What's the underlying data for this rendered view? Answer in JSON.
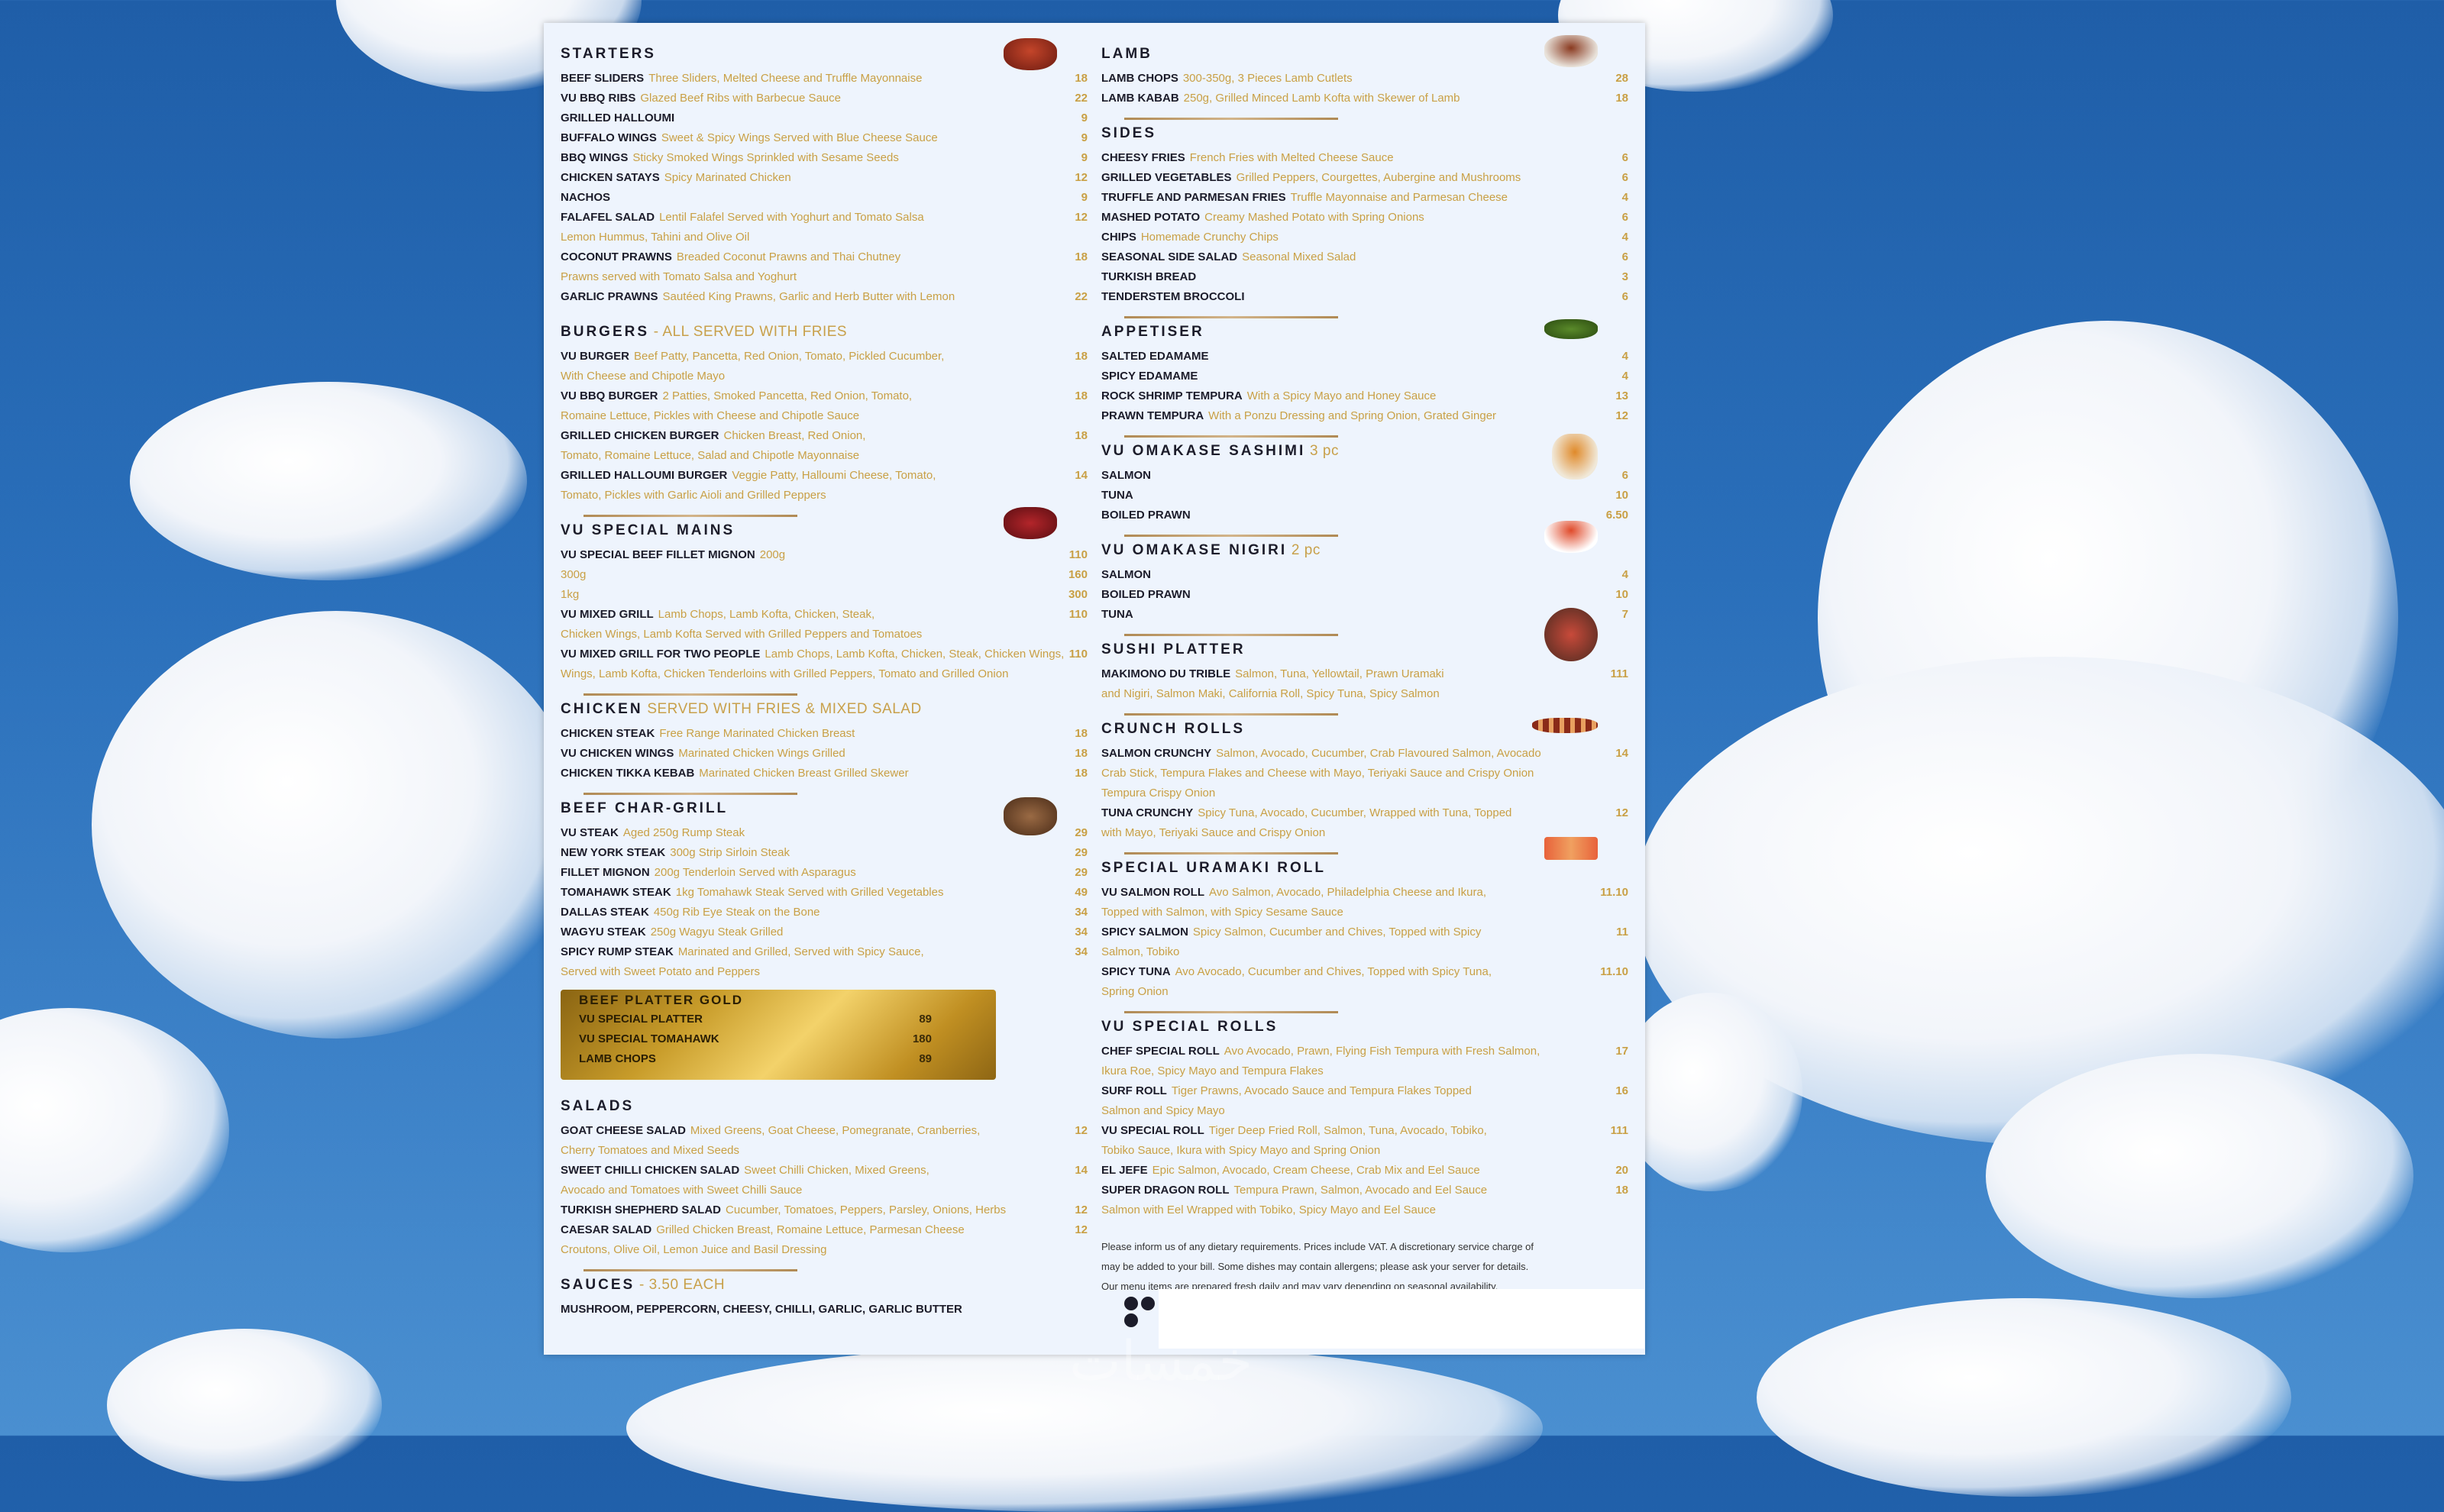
{
  "colors": {
    "sky": "#2a6fba",
    "paper": "#eef4fd",
    "gold": "#c9a045",
    "ink": "#1c1c2a"
  },
  "left": {
    "starters": {
      "title": "STARTERS",
      "items": [
        {
          "name": "BEEF SLIDERS",
          "desc": "Three Sliders, Melted Cheese and Truffle Mayonnaise",
          "price": "18"
        },
        {
          "name": "VU BBQ RIBS",
          "desc": "Glazed Beef Ribs with Barbecue Sauce",
          "price": "22"
        },
        {
          "name": "GRILLED HALLOUMI",
          "desc": "",
          "price": "9"
        },
        {
          "name": "BUFFALO WINGS",
          "desc": "Sweet & Spicy Wings Served with Blue Cheese Sauce",
          "price": "9"
        },
        {
          "name": "BBQ WINGS",
          "desc": "Sticky Smoked Wings Sprinkled with Sesame Seeds",
          "price": "9"
        },
        {
          "name": "CHICKEN SATAYS",
          "desc": "Spicy Marinated Chicken",
          "price": "12"
        },
        {
          "name": "NACHOS",
          "desc": "",
          "price": "9"
        },
        {
          "name": "FALAFEL SALAD",
          "desc": "Lentil Falafel Served with Yoghurt and Tomato Salsa",
          "price": "12"
        },
        {
          "name": "",
          "desc": "Lemon Hummus, Tahini and Olive Oil",
          "price": ""
        },
        {
          "name": "COCONUT PRAWNS",
          "desc": "Breaded Coconut Prawns and Thai Chutney",
          "price": "18"
        },
        {
          "name": "",
          "desc": "Prawns served with Tomato Salsa and Yoghurt",
          "price": ""
        },
        {
          "name": "GARLIC PRAWNS",
          "desc": "Sautéed King Prawns, Garlic and Herb Butter with Lemon",
          "price": "22"
        }
      ]
    },
    "burgers": {
      "title": "BURGERS",
      "subtitle": " - ALL SERVED WITH FRIES",
      "items": [
        {
          "name": "VU BURGER",
          "desc": "Beef Patty, Pancetta, Red Onion, Tomato, Pickled Cucumber,",
          "price": "18"
        },
        {
          "name": "",
          "desc": "With Cheese and Chipotle Mayo",
          "price": ""
        },
        {
          "name": "VU BBQ BURGER",
          "desc": "2 Patties, Smoked Pancetta, Red Onion, Tomato,",
          "price": "18"
        },
        {
          "name": "",
          "desc": "Romaine Lettuce, Pickles with Cheese and Chipotle Sauce",
          "price": ""
        },
        {
          "name": "GRILLED CHICKEN BURGER",
          "desc": "Chicken Breast, Red Onion,",
          "price": "18"
        },
        {
          "name": "",
          "desc": "Tomato, Romaine Lettuce, Salad and Chipotle Mayonnaise",
          "price": ""
        },
        {
          "name": "GRILLED HALLOUMI BURGER",
          "desc": "Veggie Patty, Halloumi Cheese, Tomato,",
          "price": "14"
        },
        {
          "name": "",
          "desc": "Tomato, Pickles with Garlic Aioli and Grilled Peppers",
          "price": ""
        }
      ]
    },
    "vu_mains": {
      "title": "VU SPECIAL MAINS",
      "items": [
        {
          "name": "VU SPECIAL BEEF FILLET MIGNON",
          "desc": "200g",
          "price": "110"
        },
        {
          "name": "",
          "desc": "300g",
          "price": "160"
        },
        {
          "name": "",
          "desc": "1kg",
          "price": "300"
        },
        {
          "name": "VU MIXED GRILL",
          "desc": "Lamb Chops, Lamb Kofta, Chicken, Steak,",
          "price": "110"
        },
        {
          "name": "",
          "desc": "Chicken Wings, Lamb Kofta Served with Grilled Peppers and Tomatoes",
          "price": ""
        },
        {
          "name": "VU MIXED GRILL FOR TWO PEOPLE",
          "desc": "Lamb Chops, Lamb Kofta, Chicken, Steak, Chicken Wings,",
          "price": "110"
        },
        {
          "name": "",
          "desc": "Wings, Lamb Kofta, Chicken Tenderloins with Grilled Peppers, Tomato and Grilled Onion",
          "price": ""
        }
      ]
    },
    "chicken": {
      "title": "CHICKEN",
      "subtitle": " SERVED WITH FRIES & MIXED SALAD",
      "items": [
        {
          "name": "CHICKEN STEAK",
          "desc": "Free Range Marinated Chicken Breast",
          "price": "18"
        },
        {
          "name": "VU CHICKEN WINGS",
          "desc": "Marinated Chicken Wings Grilled",
          "price": "18"
        },
        {
          "name": "CHICKEN TIKKA KEBAB",
          "desc": "Marinated Chicken Breast Grilled Skewer",
          "price": "18"
        }
      ]
    },
    "beef": {
      "title": "BEEF CHAR-GRILL",
      "items": [
        {
          "name": "VU STEAK",
          "desc": "Aged 250g Rump Steak",
          "price": "29"
        },
        {
          "name": "NEW YORK STEAK",
          "desc": "300g Strip Sirloin Steak",
          "price": "29"
        },
        {
          "name": "FILLET MIGNON",
          "desc": "200g Tenderloin Served with Asparagus",
          "price": "29"
        },
        {
          "name": "TOMAHAWK STEAK",
          "desc": "1kg Tomahawk Steak Served with Grilled Vegetables",
          "price": "49"
        },
        {
          "name": "DALLAS STEAK",
          "desc": "450g Rib Eye Steak on the Bone",
          "price": "34"
        },
        {
          "name": "WAGYU STEAK",
          "desc": "250g Wagyu Steak Grilled",
          "price": "34"
        },
        {
          "name": "SPICY RUMP STEAK",
          "desc": "Marinated and Grilled, Served with Spicy Sauce,",
          "price": "34"
        },
        {
          "name": "",
          "desc": "Served with Sweet Potato and Peppers",
          "price": ""
        }
      ]
    },
    "gold": {
      "title": "BEEF PLATTER GOLD",
      "items": [
        {
          "name": "VU SPECIAL PLATTER",
          "price": "89"
        },
        {
          "name": "VU SPECIAL TOMAHAWK",
          "price": "180"
        },
        {
          "name": "LAMB CHOPS",
          "price": "89"
        }
      ]
    },
    "salads": {
      "title": "SALADS",
      "items": [
        {
          "name": "GOAT CHEESE SALAD",
          "desc": "Mixed Greens, Goat Cheese, Pomegranate, Cranberries,",
          "price": "12"
        },
        {
          "name": "",
          "desc": "Cherry Tomatoes and Mixed Seeds",
          "price": ""
        },
        {
          "name": "SWEET CHILLI CHICKEN SALAD",
          "desc": "Sweet Chilli Chicken, Mixed Greens,",
          "price": "14"
        },
        {
          "name": "",
          "desc": "Avocado and Tomatoes with Sweet Chilli Sauce",
          "price": ""
        },
        {
          "name": "TURKISH SHEPHERD SALAD",
          "desc": "Cucumber, Tomatoes, Peppers, Parsley, Onions, Herbs",
          "price": "12"
        },
        {
          "name": "CAESAR SALAD",
          "desc": "Grilled Chicken Breast, Romaine Lettuce, Parmesan Cheese",
          "price": "12"
        },
        {
          "name": "",
          "desc": "Croutons, Olive Oil, Lemon Juice and Basil Dressing",
          "price": ""
        }
      ]
    },
    "sauces": {
      "title": "SAUCES",
      "subtitle": " - 3.50 EACH",
      "line": "MUSHROOM, PEPPERCORN, CHEESY, CHILLI, GARLIC, GARLIC BUTTER"
    }
  },
  "right": {
    "lamb": {
      "title": "LAMB",
      "items": [
        {
          "name": "LAMB CHOPS",
          "desc": "300-350g, 3 Pieces Lamb Cutlets",
          "price": "28"
        },
        {
          "name": "LAMB KABAB",
          "desc": "250g, Grilled Minced Lamb Kofta with Skewer of Lamb",
          "price": "18"
        }
      ]
    },
    "sides": {
      "title": "SIDES",
      "items": [
        {
          "name": "CHEESY FRIES",
          "desc": "French Fries with Melted Cheese Sauce",
          "price": "6"
        },
        {
          "name": "GRILLED VEGETABLES",
          "desc": "Grilled Peppers, Courgettes, Aubergine and Mushrooms",
          "price": "6"
        },
        {
          "name": "TRUFFLE AND PARMESAN FRIES",
          "desc": "Truffle Mayonnaise and Parmesan Cheese",
          "price": "4"
        },
        {
          "name": "MASHED POTATO",
          "desc": "Creamy Mashed Potato with Spring Onions",
          "price": "6"
        },
        {
          "name": "CHIPS",
          "desc": "Homemade Crunchy Chips",
          "price": "4"
        },
        {
          "name": "SEASONAL SIDE SALAD",
          "desc": "Seasonal Mixed Salad",
          "price": "6"
        },
        {
          "name": "TURKISH BREAD",
          "desc": "",
          "price": "3"
        },
        {
          "name": "TENDERSTEM BROCCOLI",
          "desc": "",
          "price": "6"
        }
      ]
    },
    "appetiser": {
      "title": "APPETISER",
      "items": [
        {
          "name": "SALTED EDAMAME",
          "desc": "",
          "price": "4"
        },
        {
          "name": "SPICY EDAMAME",
          "desc": "",
          "price": "4"
        },
        {
          "name": "ROCK SHRIMP TEMPURA",
          "desc": "With a Spicy Mayo and Honey Sauce",
          "price": "13"
        },
        {
          "name": "PRAWN TEMPURA",
          "desc": "With a Ponzu Dressing and Spring Onion, Grated Ginger",
          "price": "12"
        }
      ]
    },
    "sashimi": {
      "title": "VU OMAKASE SASHIMI",
      "subtitle": " 3 pc",
      "items": [
        {
          "name": "SALMON",
          "desc": "",
          "price": "6"
        },
        {
          "name": "TUNA",
          "desc": "",
          "price": "10"
        },
        {
          "name": "BOILED PRAWN",
          "desc": "",
          "price": "6.50"
        }
      ]
    },
    "nigiri": {
      "title": "VU OMAKASE NIGIRI",
      "subtitle": " 2 pc",
      "items": [
        {
          "name": "SALMON",
          "desc": "",
          "price": "4"
        },
        {
          "name": "BOILED PRAWN",
          "desc": "",
          "price": "10"
        },
        {
          "name": "TUNA",
          "desc": "",
          "price": "7"
        }
      ]
    },
    "sushi_platter": {
      "title": "SUSHI PLATTER",
      "items": [
        {
          "name": "MAKIMONO DU TRIBLE",
          "desc": "Salmon, Tuna, Yellowtail, Prawn Uramaki",
          "price": "111"
        },
        {
          "name": "",
          "desc": "and Nigiri, Salmon Maki, California Roll, Spicy Tuna, Spicy Salmon",
          "price": ""
        }
      ]
    },
    "crunch": {
      "title": "CRUNCH ROLLS",
      "items": [
        {
          "name": "SALMON CRUNCHY",
          "desc": "Salmon, Avocado, Cucumber, Crab Flavoured Salmon, Avocado",
          "price": "14"
        },
        {
          "name": "",
          "desc": "Crab Stick, Tempura Flakes and Cheese with Mayo, Teriyaki Sauce and Crispy Onion",
          "price": ""
        },
        {
          "name": "",
          "desc": "Tempura Crispy Onion",
          "price": ""
        },
        {
          "name": "TUNA CRUNCHY",
          "desc": "Spicy Tuna, Avocado, Cucumber, Wrapped with Tuna, Topped",
          "price": "12"
        },
        {
          "name": "",
          "desc": "with Mayo, Teriyaki Sauce and Crispy Onion",
          "price": ""
        }
      ]
    },
    "uramaki": {
      "title": "SPECIAL URAMAKI ROLL",
      "items": [
        {
          "name": "VU SALMON ROLL",
          "desc": "Avo Salmon, Avocado, Philadelphia Cheese and Ikura,",
          "price": "11.10"
        },
        {
          "name": "",
          "desc": "Topped with Salmon, with Spicy Sesame Sauce",
          "price": ""
        },
        {
          "name": "SPICY SALMON",
          "desc": "Spicy Salmon, Cucumber and Chives, Topped with Spicy",
          "price": "11"
        },
        {
          "name": "",
          "desc": "Salmon, Tobiko",
          "price": ""
        },
        {
          "name": "SPICY TUNA",
          "desc": "Avo Avocado, Cucumber and Chives, Topped with Spicy Tuna,",
          "price": "11.10"
        },
        {
          "name": "",
          "desc": "Spring Onion",
          "price": ""
        }
      ]
    },
    "vu_rolls": {
      "title": "VU SPECIAL ROLLS",
      "items": [
        {
          "name": "CHEF SPECIAL ROLL",
          "desc": "Avo Avocado, Prawn, Flying Fish Tempura with Fresh Salmon,",
          "price": "17"
        },
        {
          "name": "",
          "desc": "Ikura Roe, Spicy Mayo and Tempura Flakes",
          "price": ""
        },
        {
          "name": "SURF ROLL",
          "desc": "Tiger Prawns, Avocado Sauce and Tempura Flakes Topped",
          "price": "16"
        },
        {
          "name": "",
          "desc": "Salmon and Spicy Mayo",
          "price": ""
        },
        {
          "name": "VU SPECIAL ROLL",
          "desc": "Tiger Deep Fried Roll, Salmon, Tuna, Avocado, Tobiko,",
          "price": "111"
        },
        {
          "name": "",
          "desc": "Tobiko Sauce, Ikura with Spicy Mayo and Spring Onion",
          "price": ""
        },
        {
          "name": "EL JEFE",
          "desc": "Epic Salmon, Avocado, Cream Cheese, Crab Mix and Eel Sauce",
          "price": "20"
        },
        {
          "name": "SUPER DRAGON ROLL",
          "desc": "Tempura Prawn, Salmon, Avocado and Eel Sauce",
          "price": "18"
        },
        {
          "name": "",
          "desc": "Salmon with Eel Wrapped with Tobiko, Spicy Mayo and Eel Sauce",
          "price": ""
        }
      ]
    },
    "notes": [
      "Please inform us of any dietary requirements. Prices include VAT. A discretionary service charge of",
      "may be added to your bill. Some dishes may contain allergens; please ask your server for details.",
      "Our menu items are prepared fresh daily and may vary depending on seasonal availability."
    ]
  },
  "icons": [
    "facebook-icon",
    "instagram-icon",
    "tripadvisor-icon"
  ],
  "watermark": "خمسات"
}
